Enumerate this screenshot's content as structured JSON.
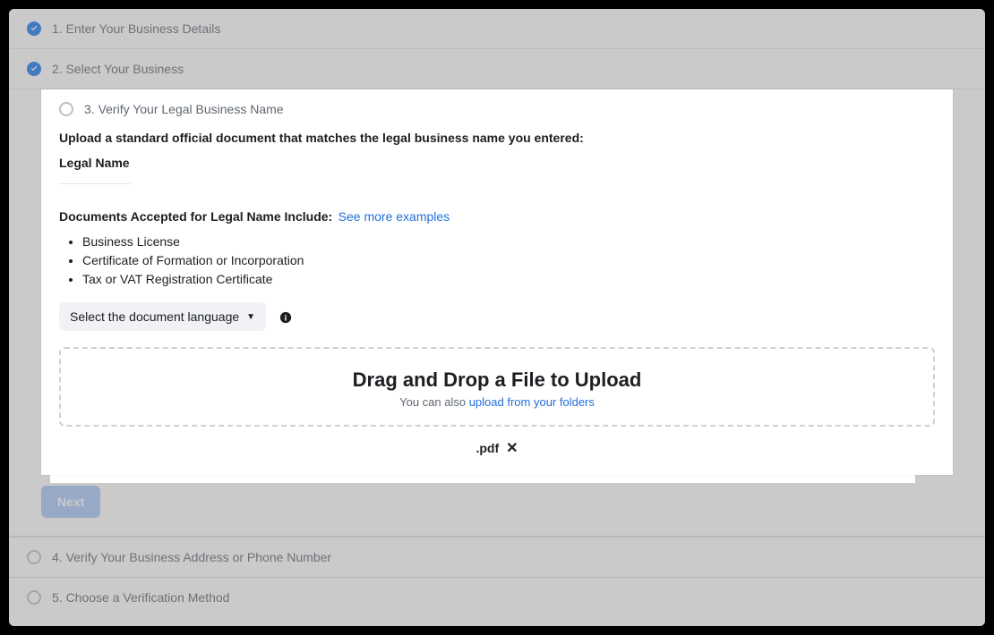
{
  "steps": {
    "s1": "1. Enter Your Business Details",
    "s2": "2. Select Your Business",
    "s3": "3. Verify Your Legal Business Name",
    "s4": "4. Verify Your Business Address or Phone Number",
    "s5": "5. Choose a Verification Method"
  },
  "panel": {
    "instruction": "Upload a standard official document that matches the legal business name you entered:",
    "legal_name_label": "Legal Name",
    "docs_heading": "Documents Accepted for Legal Name Include:",
    "see_more": "See more examples",
    "doc_items": {
      "d0": "Business License",
      "d1": "Certificate of Formation or Incorporation",
      "d2": "Tax or VAT Registration Certificate"
    },
    "lang_select_label": "Select the document language",
    "dropzone_title": "Drag and Drop a File to Upload",
    "dropzone_sub_prefix": "You can also ",
    "dropzone_sub_link": "upload from your folders",
    "uploaded_file_suffix": ".pdf",
    "next_label": "Next"
  }
}
